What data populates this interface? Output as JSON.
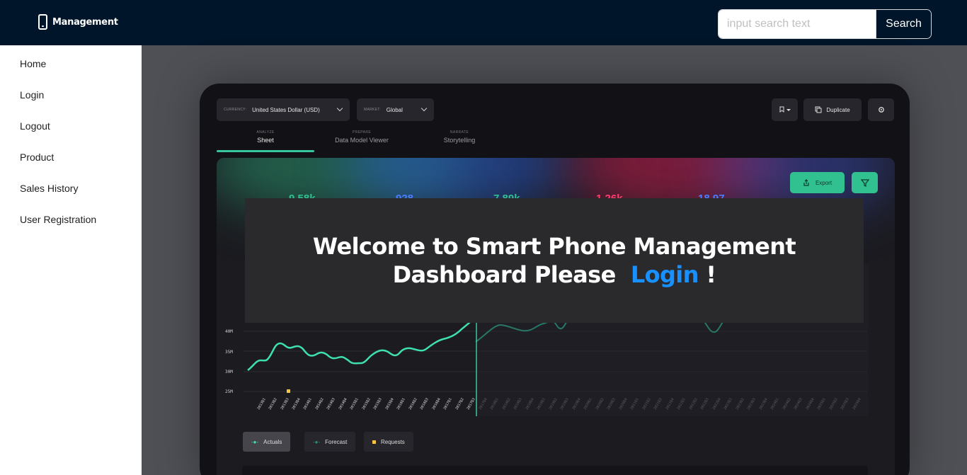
{
  "header": {
    "brand": "Management",
    "search_placeholder": "input search text",
    "search_button": "Search"
  },
  "sidebar": {
    "items": [
      {
        "label": "Home"
      },
      {
        "label": "Login"
      },
      {
        "label": "Logout"
      },
      {
        "label": "Product"
      },
      {
        "label": "Sales History"
      },
      {
        "label": "User Registration"
      }
    ]
  },
  "dashboard": {
    "currency_key": "CURRENCY:",
    "currency_value": "United States Dollar (USD)",
    "market_key": "MARKET:",
    "market_value": "Global",
    "duplicate_label": "Duplicate",
    "tabs": [
      {
        "kicker": "ANALYZE",
        "label": "Sheet"
      },
      {
        "kicker": "PREPARE",
        "label": "Data Model Viewer"
      },
      {
        "kicker": "NARRATE",
        "label": "Storytelling"
      }
    ],
    "export_label": "Export",
    "kpis": [
      "9.58k",
      "928",
      "7.89k",
      "1.26k",
      "18.97"
    ],
    "y_ticks": [
      "25M",
      "30M",
      "35M",
      "40M"
    ],
    "legend": [
      "Actuals",
      "Forecast",
      "Requests"
    ],
    "colors": {
      "accent": "#31c090",
      "line": "#3fe0b0",
      "requests": "#f5c542"
    }
  },
  "welcome": {
    "text_before": "Welcome to Smart Phone Management Dashboard Please",
    "link": "Login",
    "text_after": "!"
  }
}
